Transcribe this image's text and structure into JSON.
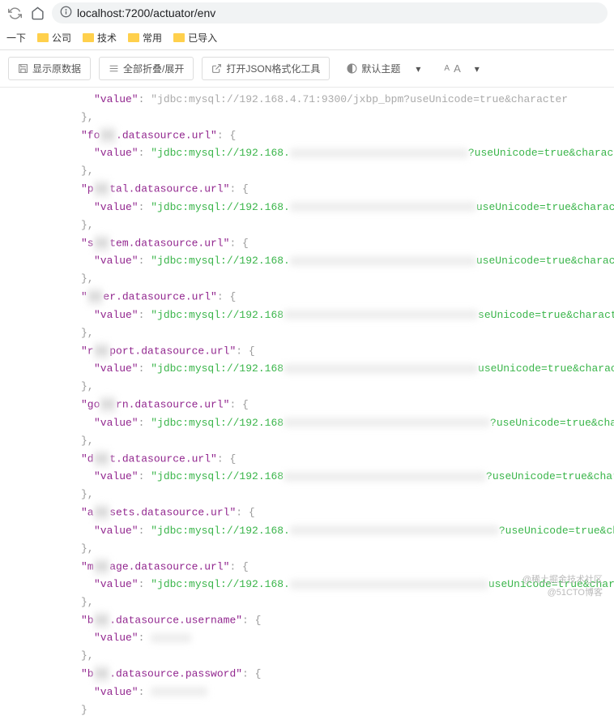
{
  "url_path": "localhost:7200/actuator/env",
  "bookmarks": {
    "b0": "一下",
    "b1": "公司",
    "b2": "技术",
    "b3": "常用",
    "b4": "已导入"
  },
  "toolbar": {
    "raw": "显示原数据",
    "fold": "全部折叠/展开",
    "format": "打开JSON格式化工具",
    "theme": "默认主题"
  },
  "json": {
    "valkey": "\"value\"",
    "topval": "\"jdbc:mysql://192.168.4.71:9300/jxbp_bpm?useUnicode=true&character",
    "punc_obj": ": {",
    "punc_close": "},",
    "punc_colon": ": ",
    "k1": ".datasource.url\"",
    "v1": "\"jdbc:mysql://192.168.",
    "t1": "?useUnicode=true&character",
    "k2": "tal.datasource.url\"",
    "v2": "\"jdbc:mysql://192.168.",
    "t2": "useUnicode=true&charact",
    "k3": "tem.datasource.url\"",
    "v3": "\"jdbc:mysql://192.168.",
    "t3": "useUnicode=true&charact",
    "k4": "er.datasource.url\"",
    "v4": "\"jdbc:mysql://192.168",
    "t4": "seUnicode=true&character",
    "k5": "port.datasource.url\"",
    "v5": "\"jdbc:mysql://192.168",
    "t5": "useUnicode=true&charac",
    "k6": "rn.datasource.url\"",
    "v6": "\"jdbc:mysql://192.168",
    "t6": "?useUnicode=true&char",
    "k7": "t.datasource.url\"",
    "v7": "\"jdbc:mysql://192.168",
    "t7": "?useUnicode=true&chara",
    "k8": "sets.datasource.url\"",
    "v8": "\"jdbc:mysql://192.168.",
    "t8": "?useUnicode=true&cha",
    "k9": "age.datasource.url\"",
    "v9": "\"jdbc:mysql://192.168.",
    "t9": "useUnicode=true&char",
    "k10": ".datasource.username\"",
    "v10": "",
    "k11": ".datasource.password\"",
    "v11": "",
    "p_fo": "\"fo",
    "p_p": "\"p",
    "p_s": "\"s",
    "p_r2": "\"r",
    "p_go": "\"go",
    "p_d": "\"d",
    "p_a": "\"a",
    "p_m": "\"m",
    "p_b": "\"b"
  },
  "watermark": {
    "l1": "@稀土掘金技术社区",
    "l2": "@51CTO博客"
  }
}
